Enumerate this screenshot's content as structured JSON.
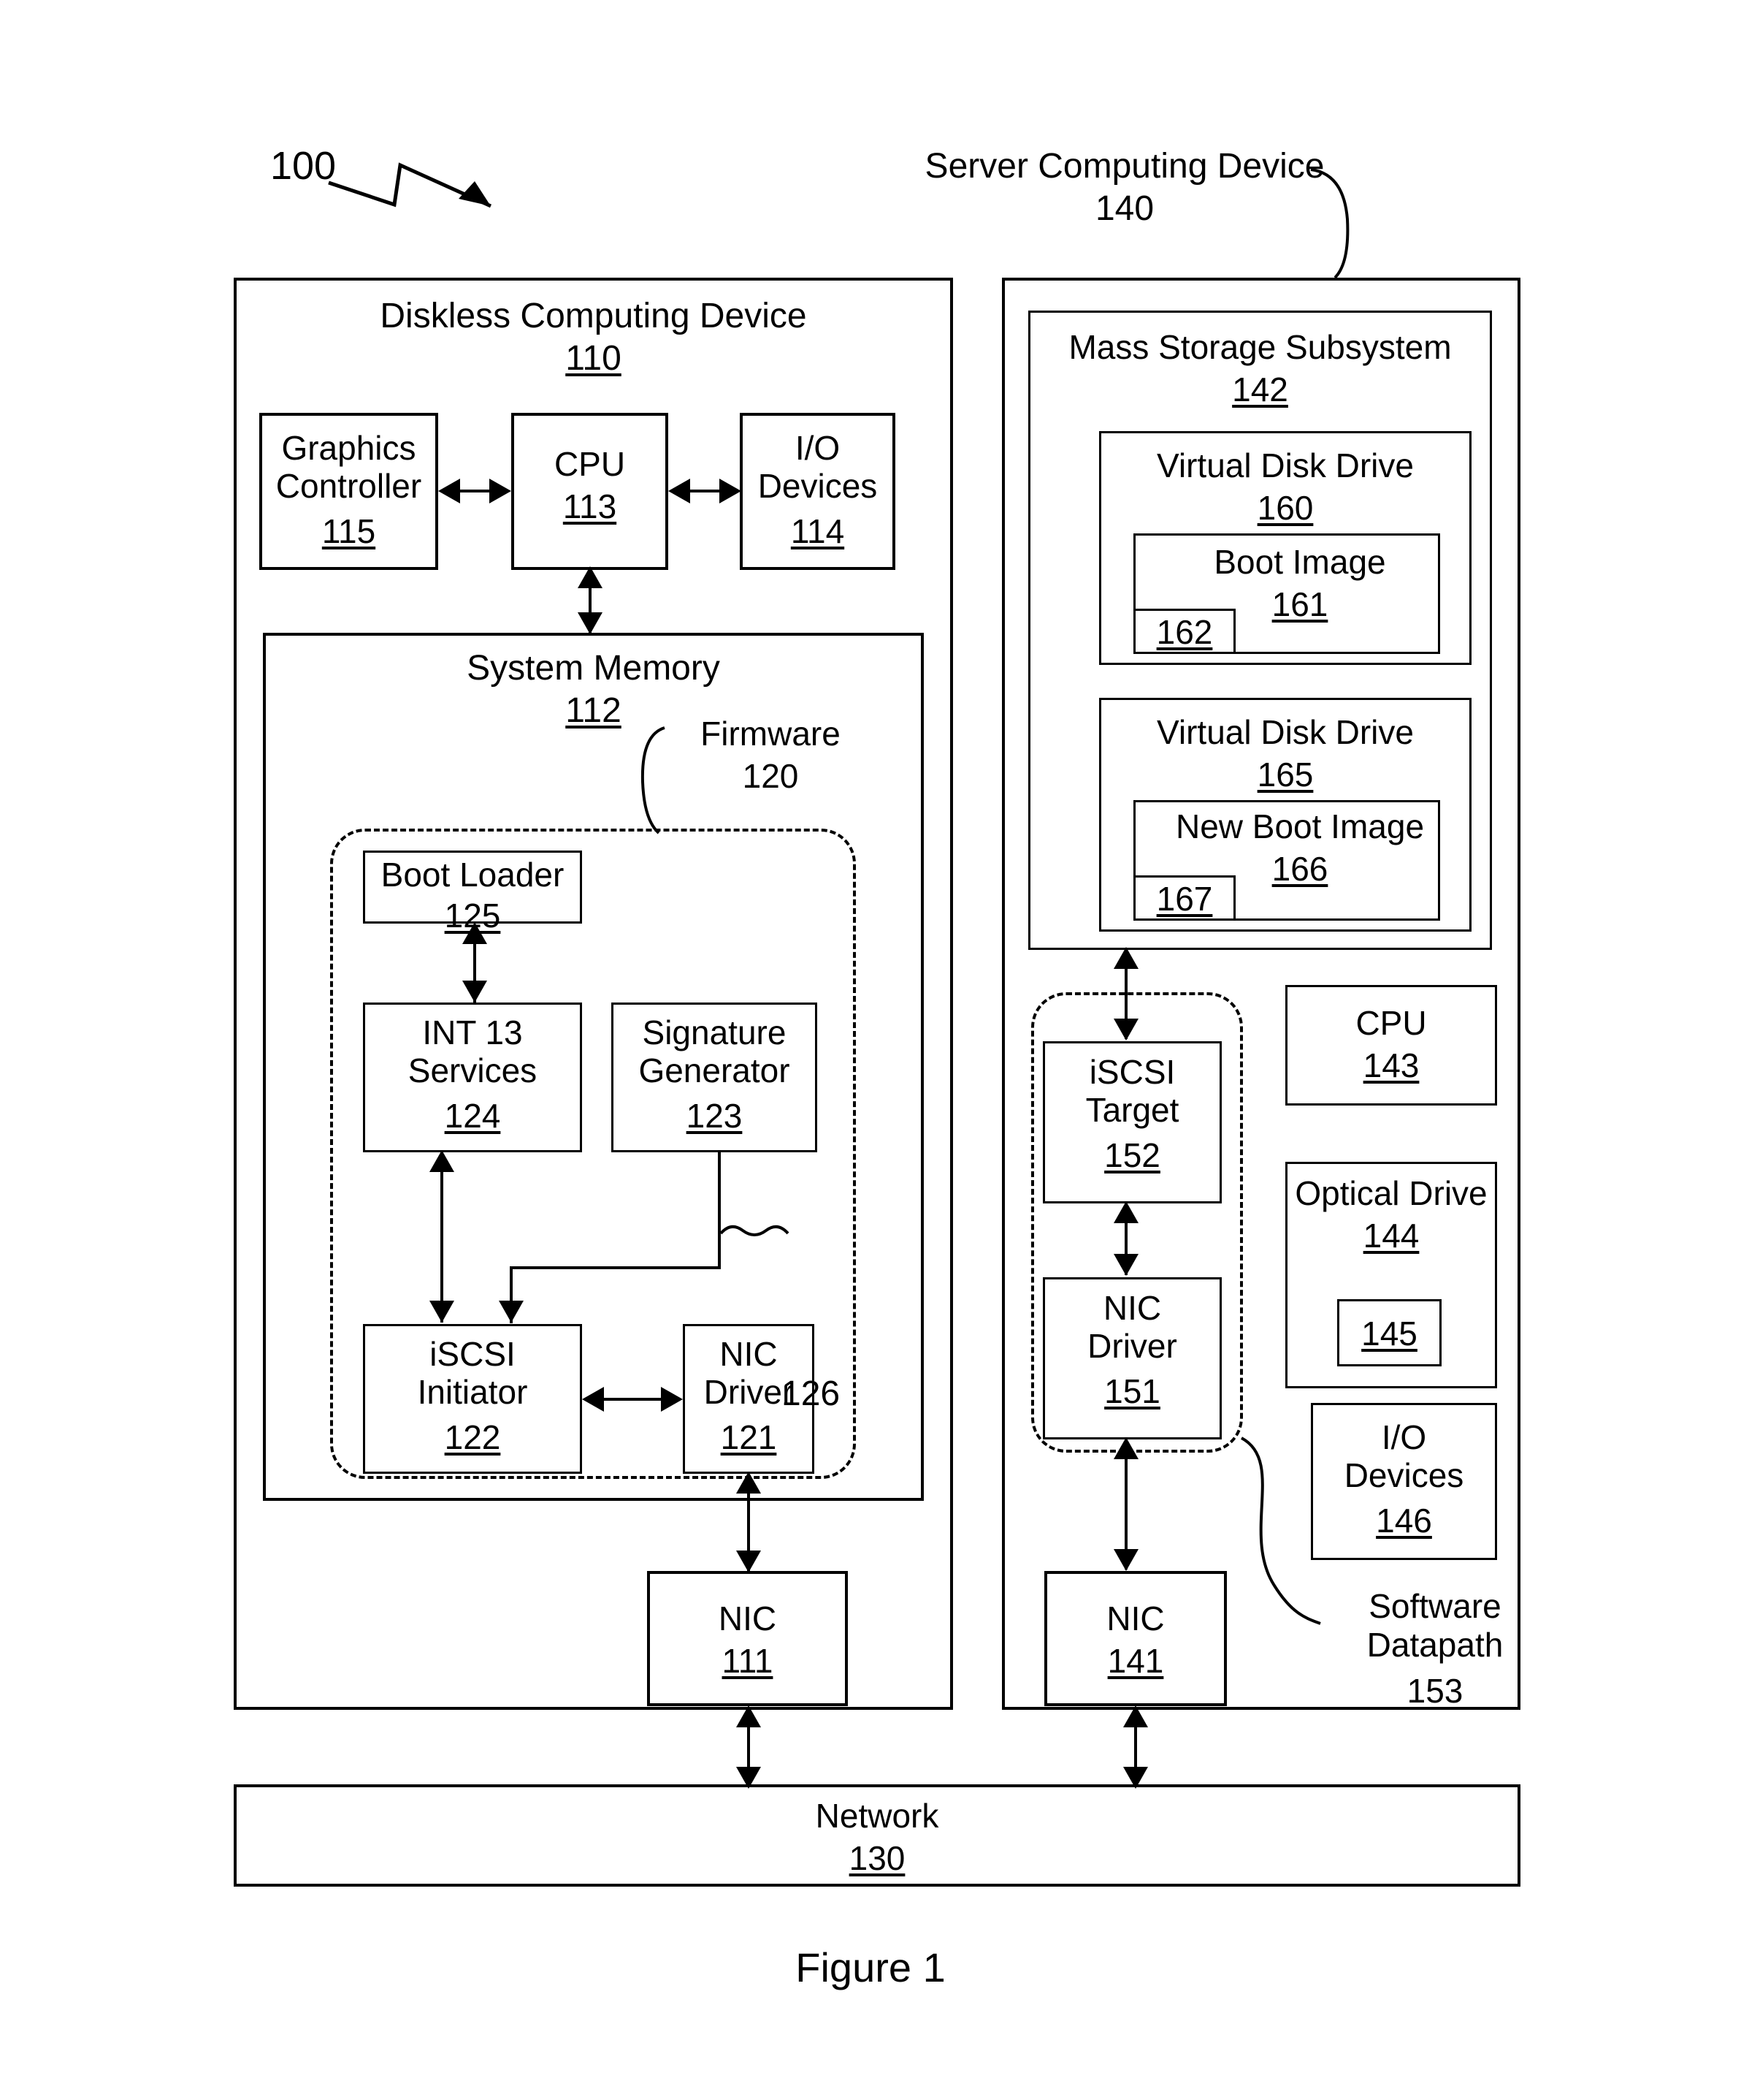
{
  "figure": {
    "caption": "Figure 1",
    "system_ref": "100"
  },
  "diskless_device": {
    "title": "Diskless Computing Device",
    "ref": "110",
    "graphics_controller": {
      "label": "Graphics\nController",
      "ref": "115"
    },
    "cpu": {
      "label": "CPU",
      "ref": "113"
    },
    "io_devices": {
      "label": "I/O\nDevices",
      "ref": "114"
    },
    "system_memory": {
      "title": "System Memory",
      "ref": "112",
      "firmware": {
        "label": "Firmware",
        "ref": "120",
        "boot_loader": {
          "label": "Boot Loader",
          "ref": "125"
        },
        "int13_services": {
          "label": "INT 13\nServices",
          "ref": "124"
        },
        "signature_generator": {
          "label": "Signature\nGenerator",
          "ref": "123"
        },
        "iscsi_initiator": {
          "label": "iSCSI\nInitiator",
          "ref": "122"
        },
        "nic_driver": {
          "label": "NIC\nDriver",
          "ref": "121"
        },
        "datapath_ref": "126"
      }
    },
    "nic": {
      "label": "NIC",
      "ref": "111"
    }
  },
  "server_device": {
    "title": "Server Computing Device",
    "ref": "140",
    "mass_storage": {
      "title": "Mass Storage Subsystem",
      "ref": "142",
      "virtual_disk_drives": [
        {
          "label": "Virtual Disk Drive",
          "ref": "160",
          "image": {
            "label": "Boot Image",
            "ref": "161",
            "inner_ref": "162"
          }
        },
        {
          "label": "Virtual Disk Drive",
          "ref": "165",
          "image": {
            "label": "New Boot Image",
            "ref": "166",
            "inner_ref": "167"
          }
        }
      ]
    },
    "iscsi_target": {
      "label": "iSCSI\nTarget",
      "ref": "152"
    },
    "nic_driver": {
      "label": "NIC\nDriver",
      "ref": "151"
    },
    "software_datapath": {
      "label": "Software\nDatapath",
      "ref": "153"
    },
    "cpu": {
      "label": "CPU",
      "ref": "143"
    },
    "optical_drive": {
      "label": "Optical Drive",
      "ref": "144",
      "media_ref": "145"
    },
    "io_devices": {
      "label": "I/O\nDevices",
      "ref": "146"
    },
    "nic": {
      "label": "NIC",
      "ref": "141"
    }
  },
  "network": {
    "label": "Network",
    "ref": "130"
  }
}
